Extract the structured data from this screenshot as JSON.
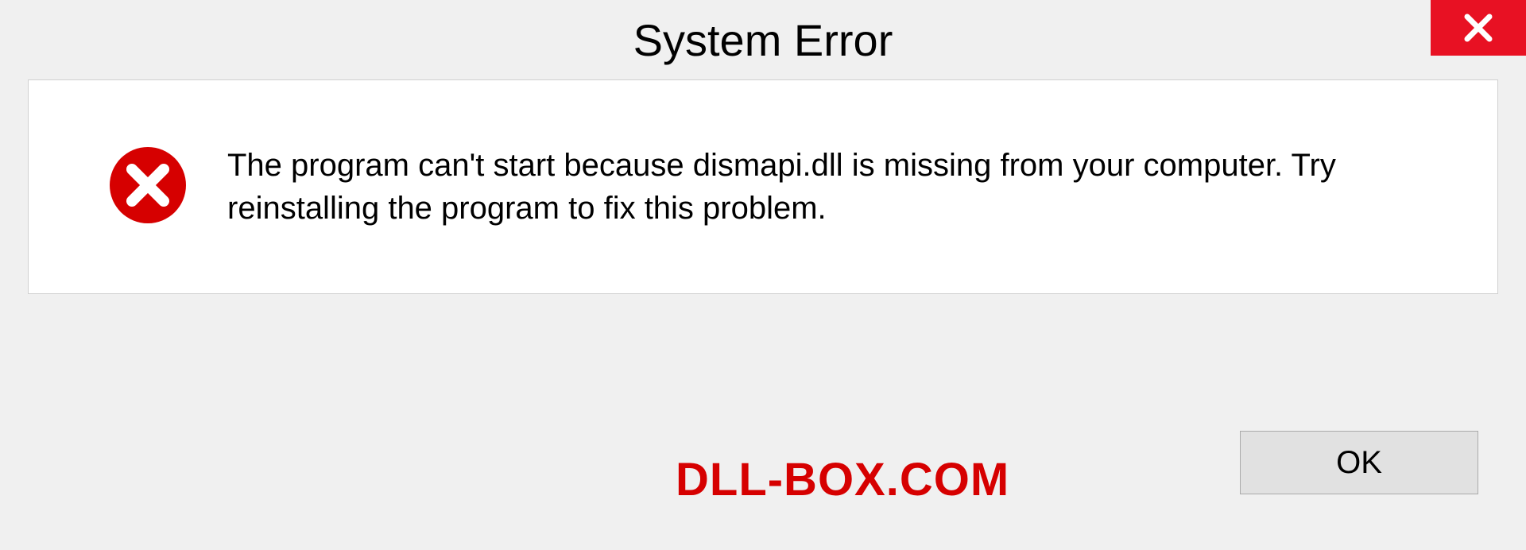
{
  "dialog": {
    "title": "System Error",
    "message": "The program can't start because dismapi.dll is missing from your computer. Try reinstalling the program to fix this problem.",
    "ok_label": "OK"
  },
  "watermark": "DLL-BOX.COM"
}
